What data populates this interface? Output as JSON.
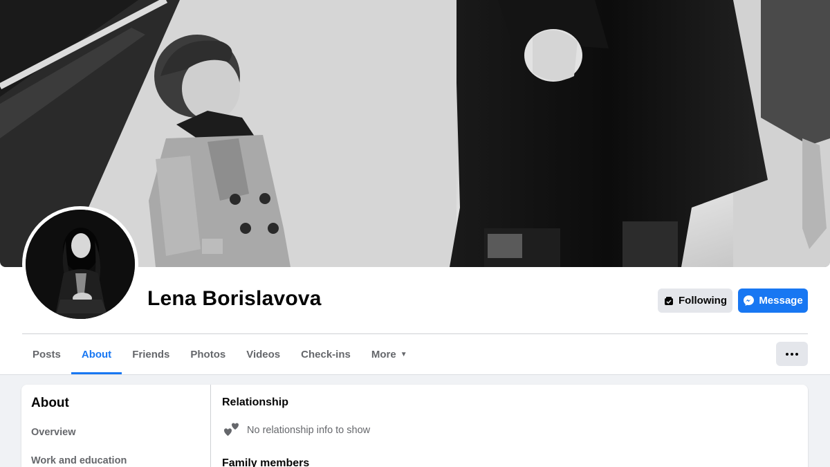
{
  "profile": {
    "name": "Lena Borislavova",
    "following_label": "Following",
    "message_label": "Message"
  },
  "tabs": [
    {
      "label": "Posts",
      "active": false
    },
    {
      "label": "About",
      "active": true
    },
    {
      "label": "Friends",
      "active": false
    },
    {
      "label": "Photos",
      "active": false
    },
    {
      "label": "Videos",
      "active": false
    },
    {
      "label": "Check-ins",
      "active": false
    },
    {
      "label": "More",
      "active": false
    }
  ],
  "about": {
    "title": "About",
    "nav": [
      "Overview",
      "Work and education"
    ],
    "relationship_title": "Relationship",
    "relationship_text": "No relationship info to show",
    "family_title": "Family members"
  },
  "colors": {
    "accent": "#1877f2",
    "secondary_button": "#e4e6eb",
    "page_background": "#f0f2f5",
    "secondary_text": "#65676b"
  },
  "icons": {
    "following": "following-icon",
    "message": "messenger-icon",
    "more_caret": "caret-down-icon",
    "more_options": "ellipsis-icon",
    "relationship": "hearts-icon"
  }
}
